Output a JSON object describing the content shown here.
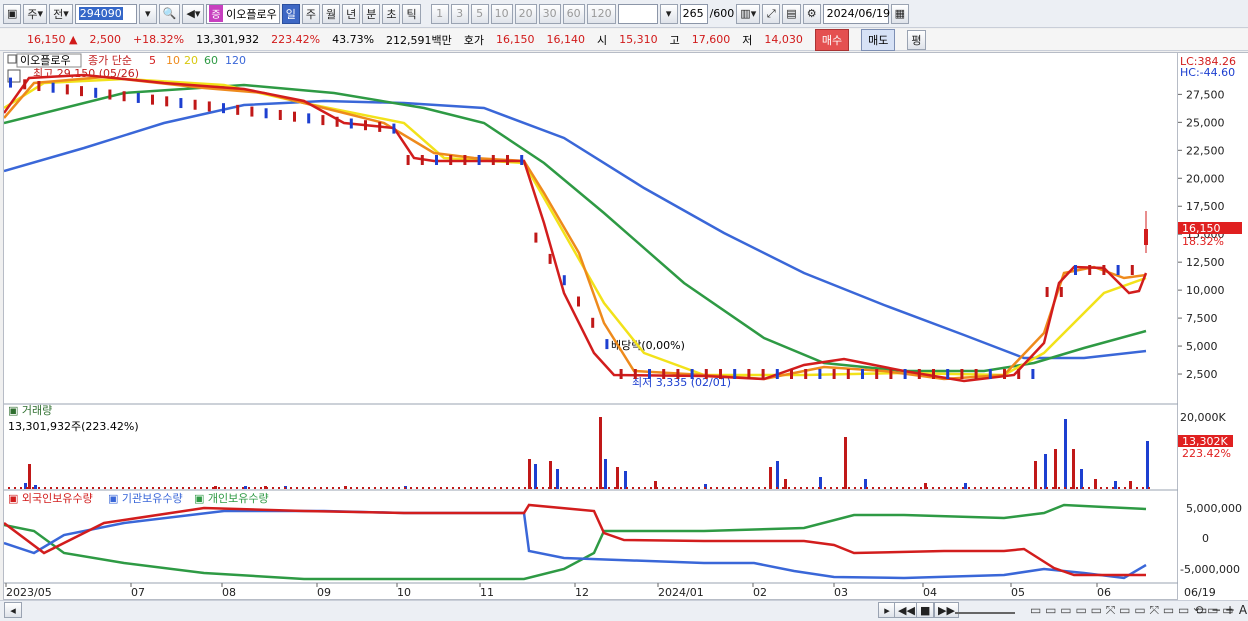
{
  "toolbar": {
    "market": "주",
    "type": "전",
    "code": "294090",
    "stock_name": "이오플로우",
    "badge": "증",
    "periods": [
      "일",
      "주",
      "월",
      "년",
      "분",
      "초",
      "틱"
    ],
    "selected_period": "일",
    "intervals": [
      "1",
      "3",
      "5",
      "10",
      "20",
      "30",
      "60",
      "120"
    ],
    "count": "265",
    "count_max": "/600",
    "date": "2024/06/19"
  },
  "quote": {
    "price": "16,150",
    "arrow": "▲",
    "change": "2,500",
    "change_pct": "+18.32%",
    "volume": "13,301,932",
    "volume_pct": "223.42%",
    "turnover_pct": "43.73%",
    "amount": "212,591백만",
    "ask_label": "호가",
    "ask": "16,150",
    "bid": "16,140",
    "open_label": "시",
    "open": "15,310",
    "high_label": "고",
    "high": "17,600",
    "low_label": "저",
    "low": "14,030",
    "buy_label": "매수",
    "sell_label": "매도",
    "extra_label": "평"
  },
  "price_panel": {
    "legend_name": "이오플로우",
    "legend_ma": "종가 단순",
    "ma_periods": [
      "5",
      "10",
      "20",
      "60",
      "120"
    ],
    "ma_colors": [
      "#d21d1d",
      "#ee8a1c",
      "#f2e21a",
      "#2e9a44",
      "#3a67d8"
    ],
    "high_note": "최고 29,150 (05/26)",
    "low_note": "최저 3,335 (02/01)",
    "dividend_note": "배당락(0,00%)",
    "lc": "LC:384.26",
    "hc": "HC:-44.60",
    "y_ticks": [
      "27,500",
      "25,000",
      "22,500",
      "20,000",
      "17,500",
      "15,000",
      "12,500",
      "10,000",
      "7,500",
      "5,000",
      "2,500"
    ],
    "last_price": "16,150",
    "last_pct": "18.32%"
  },
  "volume_panel": {
    "title": "거래량",
    "value": "13,301,932주(223.42%)",
    "y_ticks": [
      "20,000K",
      "10,000K"
    ],
    "last": "13,302K",
    "last_pct": "223.42%"
  },
  "holding_panel": {
    "series": [
      "외국인보유수량",
      "기관보유수량",
      "개인보유수량"
    ],
    "colors": [
      "#d21d1d",
      "#3a67d8",
      "#2e9a44"
    ],
    "y_ticks": [
      "5,000,000",
      "0",
      "-5,000,000"
    ]
  },
  "x_axis": [
    "2023/05",
    "07",
    "08",
    "09",
    "10",
    "11",
    "12",
    "2024/01",
    "02",
    "03",
    "04",
    "05",
    "06"
  ],
  "x_end": "06/19"
}
